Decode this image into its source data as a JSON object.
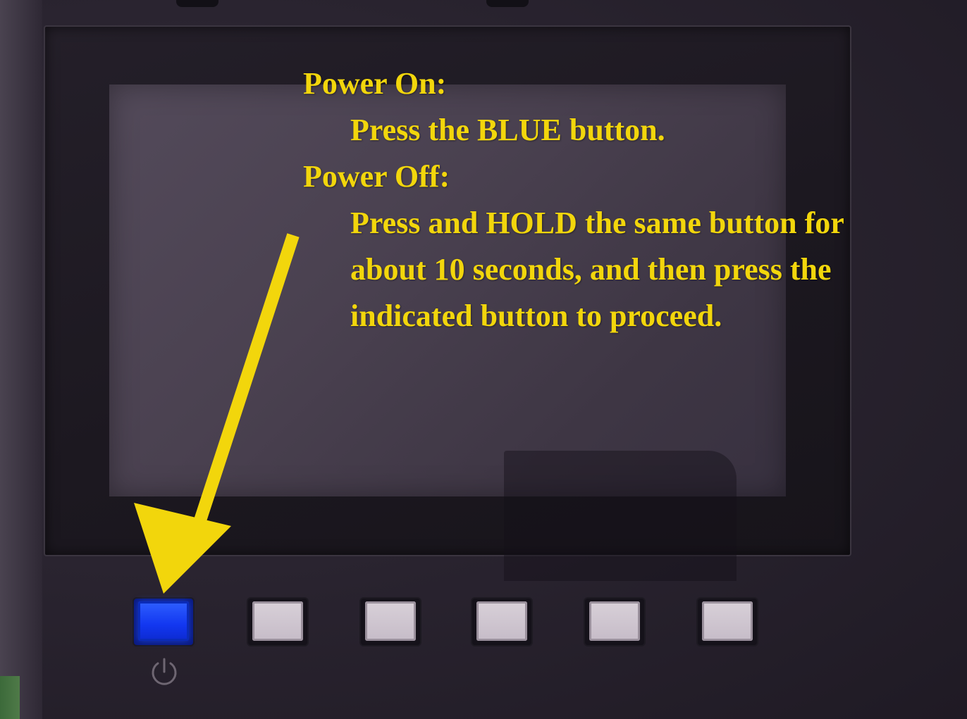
{
  "instructions": {
    "power_on_heading": "Power On:",
    "power_on_text": "Press the BLUE button.",
    "power_off_heading": "Power Off:",
    "power_off_line1": "Press and HOLD the same button for",
    "power_off_line2": "about 10 seconds, and then press the",
    "power_off_line3": "indicated button to proceed."
  },
  "colors": {
    "annotation": "#f2d60c",
    "power_button": "#1237f0",
    "function_button": "#d0c8d0"
  },
  "buttons": [
    {
      "id": "power",
      "kind": "power",
      "icon": "power-icon"
    },
    {
      "id": "f1",
      "kind": "function"
    },
    {
      "id": "f2",
      "kind": "function"
    },
    {
      "id": "f3",
      "kind": "function"
    },
    {
      "id": "f4",
      "kind": "function"
    },
    {
      "id": "f5",
      "kind": "function"
    }
  ]
}
